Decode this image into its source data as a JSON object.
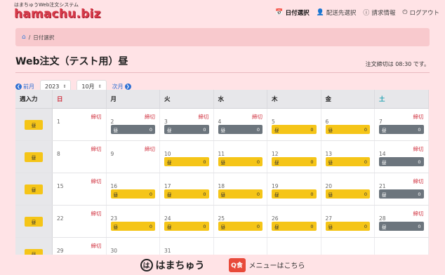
{
  "header": {
    "subtitle": "はまちゅうWeb注文システム",
    "logo": "hamachu.biz",
    "nav": [
      {
        "icon": "calendar-icon",
        "glyph": "📅",
        "label": "日付選択",
        "active": true
      },
      {
        "icon": "user-icon",
        "glyph": "👤",
        "label": "配送先選択",
        "active": false
      },
      {
        "icon": "info-icon",
        "glyph": "ⓘ",
        "label": "請求情報",
        "active": false
      },
      {
        "icon": "power-icon",
        "glyph": "⏻",
        "label": "ログアウト",
        "active": false
      }
    ]
  },
  "breadcrumb": {
    "home_icon": "⌂",
    "sep": "/",
    "current": "日付選択"
  },
  "page": {
    "title": "Web注文（テスト用）昼",
    "deadline": "注文締切は 08:30 です。"
  },
  "controls": {
    "prev": "前月",
    "year": "2023",
    "month": "10月",
    "next": "次月"
  },
  "calendar": {
    "headers": [
      "週入力",
      "日",
      "月",
      "火",
      "水",
      "木",
      "金",
      "土"
    ],
    "week_button": "昼",
    "weeks": [
      [
        {
          "n": "1",
          "kiri": "締切",
          "ord": null
        },
        {
          "n": "2",
          "kiri": "締切",
          "ord": {
            "label": "昼",
            "qty": "0",
            "state": "closed"
          }
        },
        {
          "n": "3",
          "kiri": "締切",
          "ord": {
            "label": "昼",
            "qty": "0",
            "state": "closed"
          }
        },
        {
          "n": "4",
          "kiri": "締切",
          "ord": {
            "label": "昼",
            "qty": "0",
            "state": "closed"
          }
        },
        {
          "n": "5",
          "kiri": "",
          "ord": {
            "label": "昼",
            "qty": "0",
            "state": "open"
          }
        },
        {
          "n": "6",
          "kiri": "",
          "ord": {
            "label": "昼",
            "qty": "0",
            "state": "open"
          }
        },
        {
          "n": "7",
          "kiri": "締切",
          "ord": {
            "label": "昼",
            "qty": "0",
            "state": "closed"
          }
        }
      ],
      [
        {
          "n": "8",
          "kiri": "締切",
          "ord": null
        },
        {
          "n": "9",
          "kiri": "締切",
          "ord": null
        },
        {
          "n": "10",
          "kiri": "",
          "ord": {
            "label": "昼",
            "qty": "0",
            "state": "open"
          }
        },
        {
          "n": "11",
          "kiri": "",
          "ord": {
            "label": "昼",
            "qty": "0",
            "state": "open"
          }
        },
        {
          "n": "12",
          "kiri": "",
          "ord": {
            "label": "昼",
            "qty": "0",
            "state": "open"
          }
        },
        {
          "n": "13",
          "kiri": "",
          "ord": {
            "label": "昼",
            "qty": "0",
            "state": "open"
          }
        },
        {
          "n": "14",
          "kiri": "締切",
          "ord": {
            "label": "昼",
            "qty": "0",
            "state": "closed"
          }
        }
      ],
      [
        {
          "n": "15",
          "kiri": "締切",
          "ord": null
        },
        {
          "n": "16",
          "kiri": "",
          "ord": {
            "label": "昼",
            "qty": "0",
            "state": "open"
          }
        },
        {
          "n": "17",
          "kiri": "",
          "ord": {
            "label": "昼",
            "qty": "0",
            "state": "open"
          }
        },
        {
          "n": "18",
          "kiri": "",
          "ord": {
            "label": "昼",
            "qty": "0",
            "state": "open"
          }
        },
        {
          "n": "19",
          "kiri": "",
          "ord": {
            "label": "昼",
            "qty": "0",
            "state": "open"
          }
        },
        {
          "n": "20",
          "kiri": "",
          "ord": {
            "label": "昼",
            "qty": "0",
            "state": "open"
          }
        },
        {
          "n": "21",
          "kiri": "締切",
          "ord": {
            "label": "昼",
            "qty": "0",
            "state": "closed"
          }
        }
      ],
      [
        {
          "n": "22",
          "kiri": "締切",
          "ord": null
        },
        {
          "n": "23",
          "kiri": "",
          "ord": {
            "label": "昼",
            "qty": "0",
            "state": "open"
          }
        },
        {
          "n": "24",
          "kiri": "",
          "ord": {
            "label": "昼",
            "qty": "0",
            "state": "open"
          }
        },
        {
          "n": "25",
          "kiri": "",
          "ord": {
            "label": "昼",
            "qty": "0",
            "state": "open"
          }
        },
        {
          "n": "26",
          "kiri": "",
          "ord": {
            "label": "昼",
            "qty": "0",
            "state": "open"
          }
        },
        {
          "n": "27",
          "kiri": "",
          "ord": {
            "label": "昼",
            "qty": "0",
            "state": "open"
          }
        },
        {
          "n": "28",
          "kiri": "締切",
          "ord": {
            "label": "昼",
            "qty": "0",
            "state": "closed"
          }
        }
      ],
      [
        {
          "n": "29",
          "kiri": "締切",
          "ord": null
        },
        {
          "n": "30",
          "kiri": "",
          "ord": null
        },
        {
          "n": "31",
          "kiri": "",
          "ord": null
        },
        {
          "n": "",
          "kiri": "",
          "ord": null
        },
        {
          "n": "",
          "kiri": "",
          "ord": null
        },
        {
          "n": "",
          "kiri": "",
          "ord": null
        },
        {
          "n": "",
          "kiri": "",
          "ord": null
        }
      ]
    ]
  },
  "footer": {
    "brand": "はまちゅう",
    "brand_mark": "は",
    "menu_badge": "Q食",
    "menu_link": "メニューはこちら"
  },
  "colors": {
    "accent": "#f5c518",
    "closed": "#6c757d",
    "sunday": "#d0303e",
    "saturday": "#1a9fb0",
    "link": "#2f6fd3"
  }
}
